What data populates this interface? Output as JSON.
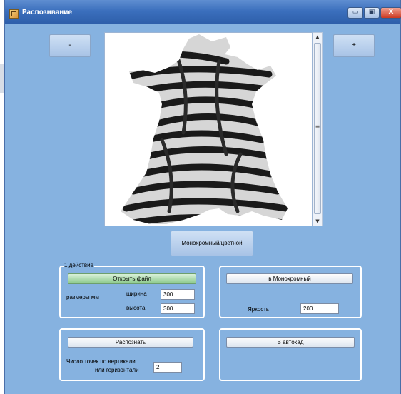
{
  "window": {
    "title": "Распознвание",
    "controls": {
      "minimize": "▭",
      "maximize": "▣",
      "close": "X"
    }
  },
  "toolbar": {
    "zoom_out": "-",
    "zoom_in": "+"
  },
  "mode_button": "Монохромный/цветной",
  "group1": {
    "legend": "1 действие",
    "open_button": "Открыть файл",
    "size_label": "размеры мм",
    "width_label": "ширина",
    "width_value": "300",
    "height_label": "высота",
    "height_value": "300"
  },
  "group2": {
    "mono_button": "в Монохромный",
    "brightness_label": "Яркость",
    "brightness_value": "200"
  },
  "group3": {
    "recognize_button": "Распознать",
    "points_label_line1": "Число точек по вертикали",
    "points_label_line2": "или горизонтали",
    "points_value": "2"
  },
  "group4": {
    "autocad_button": "В автокад"
  },
  "icons": {
    "app": "app-icon",
    "scroll_up": "▲",
    "scroll_down": "▼",
    "grip": "≡"
  }
}
